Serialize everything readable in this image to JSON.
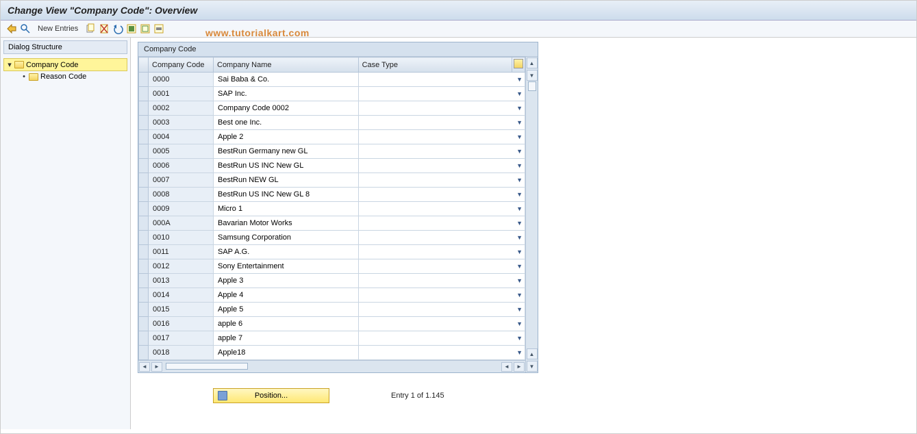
{
  "title": "Change View \"Company Code\": Overview",
  "watermark": "www.tutorialkart.com",
  "toolbar": {
    "new_entries": "New Entries"
  },
  "sidebar": {
    "header": "Dialog Structure",
    "items": [
      {
        "label": "Company Code",
        "selected": true,
        "expanded": true
      },
      {
        "label": "Reason Code",
        "selected": false,
        "child": true
      }
    ]
  },
  "panel": {
    "title": "Company Code",
    "columns": [
      "Company Code",
      "Company Name",
      "Case Type"
    ],
    "rows": [
      {
        "code": "0000",
        "name": "Sai Baba & Co.",
        "case": ""
      },
      {
        "code": "0001",
        "name": "SAP Inc.",
        "case": ""
      },
      {
        "code": "0002",
        "name": "Company Code 0002",
        "case": ""
      },
      {
        "code": "0003",
        "name": "Best one Inc.",
        "case": ""
      },
      {
        "code": "0004",
        "name": "Apple 2",
        "case": ""
      },
      {
        "code": "0005",
        "name": "BestRun Germany new GL",
        "case": ""
      },
      {
        "code": "0006",
        "name": "BestRun US INC New GL",
        "case": ""
      },
      {
        "code": "0007",
        "name": "BestRun NEW GL",
        "case": ""
      },
      {
        "code": "0008",
        "name": "BestRun US INC New GL 8",
        "case": ""
      },
      {
        "code": "0009",
        "name": "Micro 1",
        "case": ""
      },
      {
        "code": "000A",
        "name": "Bavarian Motor Works",
        "case": ""
      },
      {
        "code": "0010",
        "name": "Samsung Corporation",
        "case": ""
      },
      {
        "code": "0011",
        "name": "SAP A.G.",
        "case": ""
      },
      {
        "code": "0012",
        "name": "Sony Entertainment",
        "case": ""
      },
      {
        "code": "0013",
        "name": "Apple 3",
        "case": ""
      },
      {
        "code": "0014",
        "name": "Apple 4",
        "case": ""
      },
      {
        "code": "0015",
        "name": "Apple 5",
        "case": ""
      },
      {
        "code": "0016",
        "name": "apple 6",
        "case": ""
      },
      {
        "code": "0017",
        "name": "apple 7",
        "case": ""
      },
      {
        "code": "0018",
        "name": "Apple18",
        "case": ""
      }
    ]
  },
  "footer": {
    "position_label": "Position...",
    "entry_text": "Entry 1 of 1.145"
  }
}
